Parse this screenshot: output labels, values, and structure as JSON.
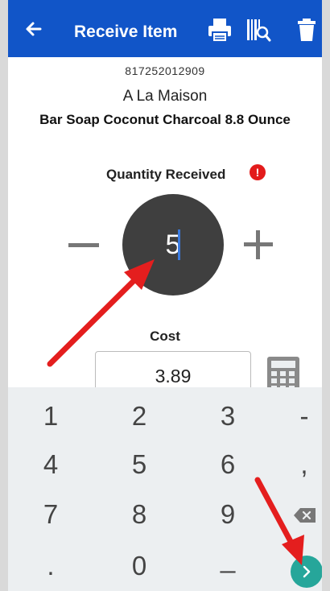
{
  "appbar": {
    "title": "Receive Item",
    "icons": [
      "back-arrow-icon",
      "printer-icon",
      "barcode-search-icon",
      "trash-icon"
    ]
  },
  "item": {
    "upc": "817252012909",
    "brand": "A La Maison",
    "name": "Bar Soap Coconut Charcoal 8.8 Ounce"
  },
  "quantity": {
    "label": "Quantity Received",
    "warning": "!",
    "value": "5"
  },
  "cost": {
    "label": "Cost",
    "value": "3.89"
  },
  "keyboard": {
    "rows": [
      [
        "1",
        "2",
        "3",
        "-"
      ],
      [
        "4",
        "5",
        "6",
        ","
      ],
      [
        "7",
        "8",
        "9",
        "backspace"
      ],
      [
        ".",
        "0",
        "_",
        "enter"
      ]
    ]
  },
  "colors": {
    "appbar": "#1155c8",
    "warning": "#e31b1b",
    "quantity_circle": "#3f3f3f",
    "enter_key": "#26a69a",
    "annotation_arrow": "#e41e1e"
  }
}
